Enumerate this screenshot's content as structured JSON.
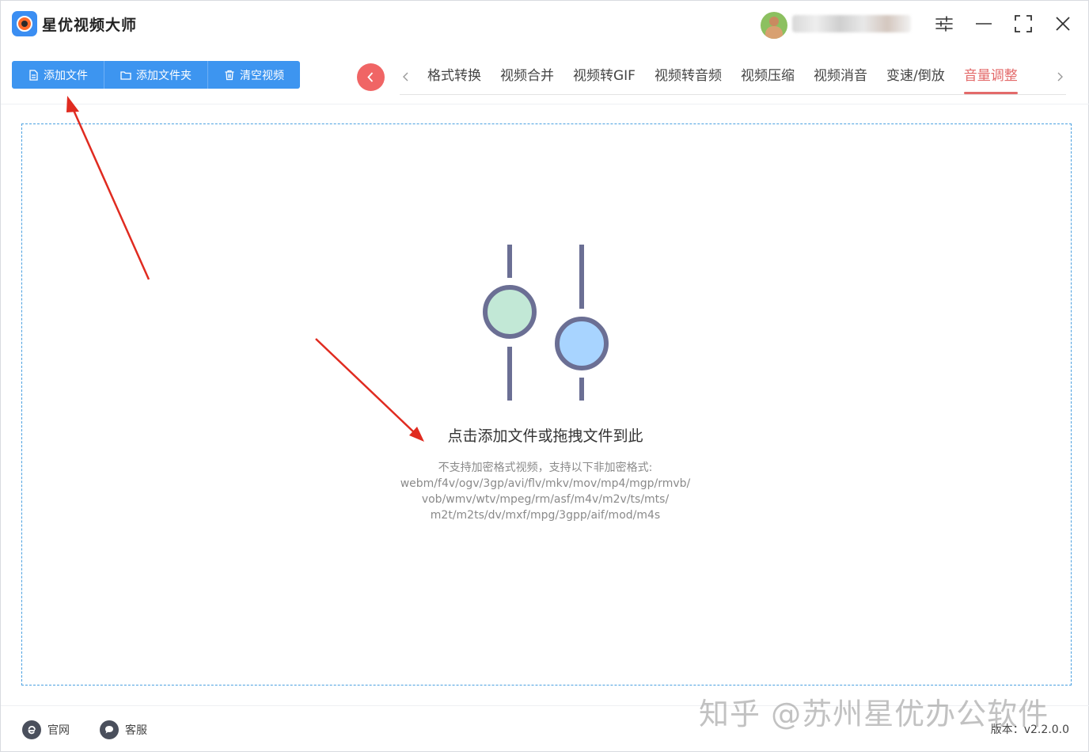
{
  "app": {
    "title": "星优视频大师",
    "user_name": "iEl 2 ... l6 5"
  },
  "toolbar": {
    "add_file": "添加文件",
    "add_folder": "添加文件夹",
    "clear_videos": "清空视频"
  },
  "tabs": [
    {
      "label": "格式转换",
      "active": false
    },
    {
      "label": "视频合并",
      "active": false
    },
    {
      "label": "视频转GIF",
      "active": false
    },
    {
      "label": "视频转音频",
      "active": false
    },
    {
      "label": "视频压缩",
      "active": false
    },
    {
      "label": "视频消音",
      "active": false
    },
    {
      "label": "变速/倒放",
      "active": false
    },
    {
      "label": "音量调整",
      "active": true
    }
  ],
  "dropzone": {
    "title": "点击添加文件或拖拽文件到此",
    "info_lines": [
      "不支持加密格式视频，支持以下非加密格式:",
      "webm/f4v/ogv/3gp/avi/flv/mkv/mov/mp4/mgp/rmvb/",
      "vob/wmv/wtv/mpeg/rm/asf/m4v/m2v/ts/mts/",
      "m2t/m2ts/dv/mxf/mpg/3gpp/aif/mod/m4s"
    ]
  },
  "footer": {
    "site_label": "官网",
    "service_label": "客服",
    "version_label": "版本：",
    "version_value": "v2.2.0.0"
  },
  "watermark": "知乎 @苏州星优办公软件",
  "colors": {
    "accent_blue": "#3d95f0",
    "active_tab": "#e36a6a",
    "back_button": "#f06565",
    "slider_green": "#c2e8d6",
    "slider_blue": "#a8d4ff",
    "slider_stroke": "#6b6f94"
  }
}
